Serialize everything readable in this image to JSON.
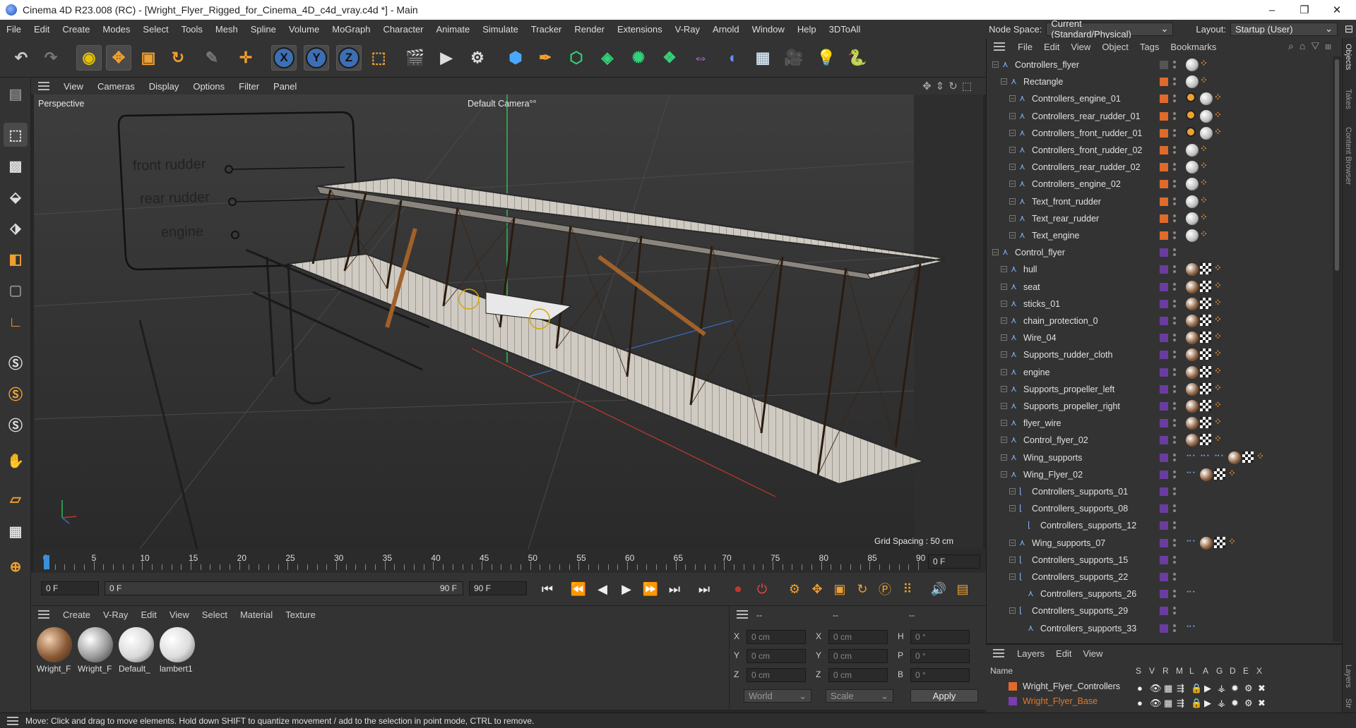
{
  "titlebar": {
    "title": "Cinema 4D R23.008 (RC) - [Wright_Flyer_Rigged_for_Cinema_4D_c4d_vray.c4d *] - Main",
    "minimize": "–",
    "maximize": "❐",
    "close": "✕"
  },
  "menubar": {
    "items": [
      "File",
      "Edit",
      "Create",
      "Modes",
      "Select",
      "Tools",
      "Mesh",
      "Spline",
      "Volume",
      "MoGraph",
      "Character",
      "Animate",
      "Simulate",
      "Tracker",
      "Render",
      "Extensions",
      "V-Ray",
      "Arnold",
      "Window",
      "Help",
      "3DToAll"
    ],
    "node_space_label": "Node Space:",
    "node_space_value": "Current (Standard/Physical)",
    "layout_label": "Layout:",
    "layout_value": "Startup (User)"
  },
  "toolbar": {
    "axis_x": "X",
    "axis_y": "Y",
    "axis_z": "Z"
  },
  "viewport": {
    "menu": [
      "View",
      "Cameras",
      "Display",
      "Options",
      "Filter",
      "Panel"
    ],
    "view_name": "Perspective",
    "camera": "Default Camera",
    "camera_suffix": "°°",
    "grid_spacing": "Grid Spacing : 50 cm",
    "controller_labels": [
      "front rudder",
      "rear rudder",
      "engine"
    ]
  },
  "timeline": {
    "ticks": [
      "0",
      "5",
      "10",
      "15",
      "20",
      "25",
      "30",
      "35",
      "40",
      "45",
      "50",
      "55",
      "60",
      "65",
      "70",
      "75",
      "80",
      "85",
      "90"
    ],
    "current_frame_right": "0 F"
  },
  "transport": {
    "start": "0 F",
    "range_start": "0 F",
    "range_end": "90 F",
    "end": "90 F"
  },
  "materials": {
    "menu": [
      "Create",
      "V-Ray",
      "Edit",
      "View",
      "Select",
      "Material",
      "Texture"
    ],
    "items": [
      {
        "name": "Wright_F",
        "color": "#8a5a36"
      },
      {
        "name": "Wright_F",
        "color": "#9a9a9a"
      },
      {
        "name": "Default_",
        "color": "#d8d8d8"
      },
      {
        "name": "lambert1",
        "color": "#dcdcdc"
      }
    ]
  },
  "coords": {
    "headers": [
      "--",
      "--",
      "--"
    ],
    "rows": [
      {
        "a": "X",
        "av": "0 cm",
        "b": "X",
        "bv": "0 cm",
        "c": "H",
        "cv": "0 °"
      },
      {
        "a": "Y",
        "av": "0 cm",
        "b": "Y",
        "bv": "0 cm",
        "c": "P",
        "cv": "0 °"
      },
      {
        "a": "Z",
        "av": "0 cm",
        "b": "Z",
        "bv": "0 cm",
        "c": "B",
        "cv": "0 °"
      }
    ],
    "world": "World",
    "scale": "Scale",
    "apply": "Apply"
  },
  "objects": {
    "menu": [
      "File",
      "Edit",
      "View",
      "Object",
      "Tags",
      "Bookmarks"
    ],
    "rows": [
      {
        "name": "Controllers_flyer",
        "indent": 0,
        "color": "#555555",
        "tags": "ball"
      },
      {
        "name": "Rectangle",
        "indent": 1,
        "color": "#e06a2a",
        "tags": "ball"
      },
      {
        "name": "Controllers_engine_01",
        "indent": 2,
        "color": "#e06a2a",
        "tags": "noball"
      },
      {
        "name": "Controllers_rear_rudder_01",
        "indent": 2,
        "color": "#e06a2a",
        "tags": "noball"
      },
      {
        "name": "Controllers_front_rudder_01",
        "indent": 2,
        "color": "#e06a2a",
        "tags": "noball"
      },
      {
        "name": "Controllers_front_rudder_02",
        "indent": 2,
        "color": "#e06a2a",
        "tags": "ball"
      },
      {
        "name": "Controllers_rear_rudder_02",
        "indent": 2,
        "color": "#e06a2a",
        "tags": "ball"
      },
      {
        "name": "Controllers_engine_02",
        "indent": 2,
        "color": "#e06a2a",
        "tags": "ball"
      },
      {
        "name": "Text_front_rudder",
        "indent": 2,
        "color": "#e06a2a",
        "tags": "ball"
      },
      {
        "name": "Text_rear_rudder",
        "indent": 2,
        "color": "#e06a2a",
        "tags": "ball"
      },
      {
        "name": "Text_engine",
        "indent": 2,
        "color": "#e06a2a",
        "tags": "ball"
      },
      {
        "name": "Control_flyer",
        "indent": 0,
        "color": "#6b3ca0",
        "tags": "none"
      },
      {
        "name": "hull",
        "indent": 1,
        "color": "#6b3ca0",
        "tags": "mat"
      },
      {
        "name": "seat",
        "indent": 1,
        "color": "#6b3ca0",
        "tags": "mat"
      },
      {
        "name": "sticks_01",
        "indent": 1,
        "color": "#6b3ca0",
        "tags": "mat"
      },
      {
        "name": "chain_protection_0",
        "indent": 1,
        "color": "#6b3ca0",
        "tags": "mat"
      },
      {
        "name": "Wire_04",
        "indent": 1,
        "color": "#6b3ca0",
        "tags": "mat"
      },
      {
        "name": "Supports_rudder_cloth",
        "indent": 1,
        "color": "#6b3ca0",
        "tags": "mat"
      },
      {
        "name": "engine",
        "indent": 1,
        "color": "#6b3ca0",
        "tags": "mat"
      },
      {
        "name": "Supports_propeller_left",
        "indent": 1,
        "color": "#6b3ca0",
        "tags": "mat"
      },
      {
        "name": "Supports_propeller_right",
        "indent": 1,
        "color": "#6b3ca0",
        "tags": "mat"
      },
      {
        "name": "flyer_wire",
        "indent": 1,
        "color": "#6b3ca0",
        "tags": "mat"
      },
      {
        "name": "Control_flyer_02",
        "indent": 1,
        "color": "#6b3ca0",
        "tags": "mat"
      },
      {
        "name": "Wing_supports",
        "indent": 1,
        "color": "#6b3ca0",
        "tags": "multi"
      },
      {
        "name": "Wing_Flyer_02",
        "indent": 1,
        "color": "#6b3ca0",
        "tags": "multi2"
      },
      {
        "name": "Controllers_supports_01",
        "indent": 2,
        "color": "#6b3ca0",
        "tags": "none"
      },
      {
        "name": "Controllers_supports_08",
        "indent": 2,
        "color": "#6b3ca0",
        "tags": "none"
      },
      {
        "name": "Controllers_supports_12",
        "indent": 3,
        "color": "#6b3ca0",
        "tags": "none"
      },
      {
        "name": "Wing_supports_07",
        "indent": 2,
        "color": "#6b3ca0",
        "tags": "multi2"
      },
      {
        "name": "Controllers_supports_15",
        "indent": 2,
        "color": "#6b3ca0",
        "tags": "none"
      },
      {
        "name": "Controllers_supports_22",
        "indent": 2,
        "color": "#6b3ca0",
        "tags": "none"
      },
      {
        "name": "Controllers_supports_26",
        "indent": 3,
        "color": "#6b3ca0",
        "tags": "dots"
      },
      {
        "name": "Controllers_supports_29",
        "indent": 2,
        "color": "#6b3ca0",
        "tags": "none"
      },
      {
        "name": "Controllers_supports_33",
        "indent": 3,
        "color": "#6b3ca0",
        "tags": "dots"
      }
    ]
  },
  "layers": {
    "menu": [
      "Layers",
      "Edit",
      "View"
    ],
    "columns": [
      "Name",
      "S",
      "V",
      "R",
      "M",
      "L",
      "A",
      "G",
      "D",
      "E",
      "X"
    ],
    "items": [
      {
        "name": "Wright_Flyer_Controllers",
        "color": "#e06a2a",
        "text_color": "#e0e0e0"
      },
      {
        "name": "Wright_Flyer_Base",
        "color": "#7a3cb0",
        "text_color": "#e07a30"
      }
    ]
  },
  "rightstrip": [
    "Objects",
    "Takes",
    "Content Browser",
    "Layers",
    "Str"
  ],
  "status": "Move: Click and drag to move elements. Hold down SHIFT to quantize movement / add to the selection in point mode, CTRL to remove."
}
